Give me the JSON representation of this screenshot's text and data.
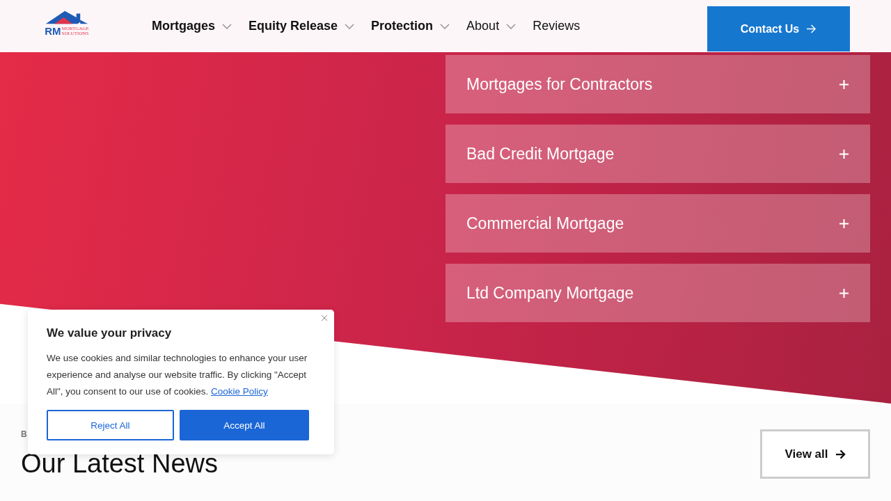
{
  "header": {
    "logo": {
      "initials": "RM",
      "line_1": "MORTGAGE",
      "line_2": "SOLUTIONS"
    },
    "nav": [
      {
        "label": "Mortgages",
        "has_dropdown": true,
        "bold": true
      },
      {
        "label": "Equity Release",
        "has_dropdown": true,
        "bold": true
      },
      {
        "label": "Protection",
        "has_dropdown": true,
        "bold": true
      },
      {
        "label": "About",
        "has_dropdown": true,
        "bold": false
      },
      {
        "label": "Reviews",
        "has_dropdown": false,
        "bold": false
      }
    ],
    "contact_button": "Contact Us"
  },
  "accordion": [
    {
      "title": "Mortgages for Contractors",
      "expanded": false
    },
    {
      "title": "Bad Credit Mortgage",
      "expanded": false
    },
    {
      "title": "Commercial Mortgage",
      "expanded": false
    },
    {
      "title": "Ltd Company Mortgage",
      "expanded": false
    }
  ],
  "news": {
    "eyebrow": "B",
    "heading": "Our Latest News",
    "view_all": "View all"
  },
  "cookie_banner": {
    "title": "We value your privacy",
    "text": "We use cookies and similar technologies to enhance your user experience and analyse our website traffic.  By clicking \"Accept All\", you consent to our use of cookies.",
    "link": "Cookie Policy",
    "reject": "Reject All",
    "accept": "Accept All"
  }
}
